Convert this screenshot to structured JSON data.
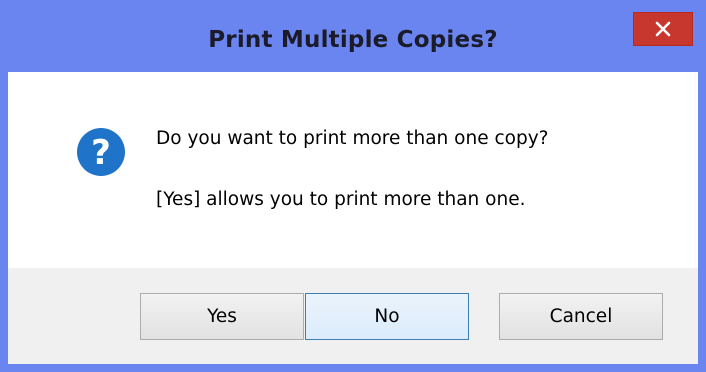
{
  "window": {
    "title": "Print Multiple Copies?"
  },
  "dialog": {
    "icon": "question-icon",
    "message_line_1": "Do you want to print more than one copy?",
    "message_line_2": "[Yes] allows you to print more than one."
  },
  "buttons": {
    "yes_label": "Yes",
    "no_label": "No",
    "cancel_label": "Cancel"
  },
  "colors": {
    "titlebar": "#6a85ef",
    "close_button": "#c8372e",
    "icon_blue": "#1f74c9"
  }
}
